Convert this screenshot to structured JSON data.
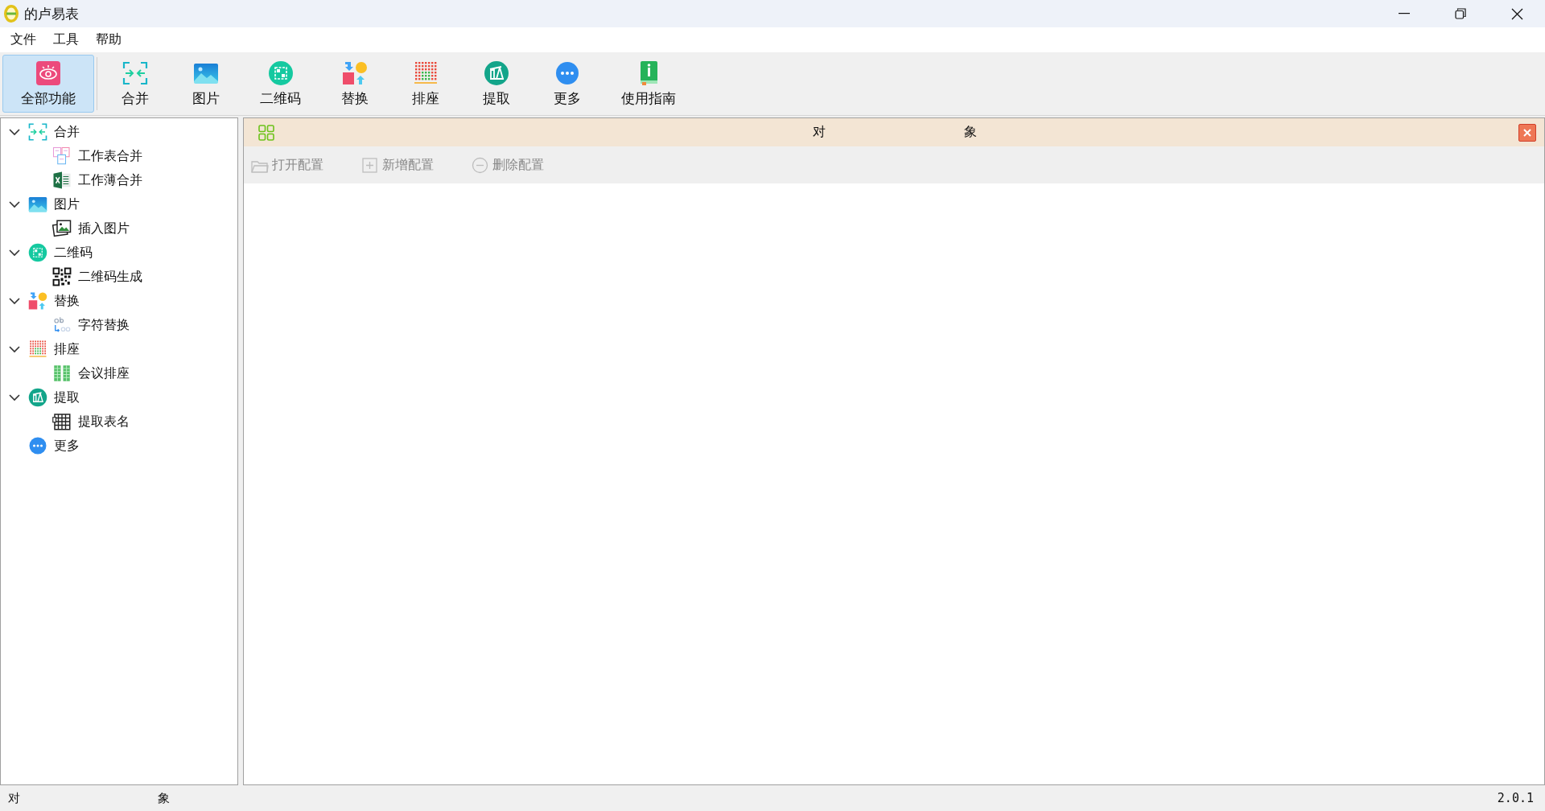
{
  "window": {
    "title": "的卢易表"
  },
  "menu": [
    "文件",
    "工具",
    "帮助"
  ],
  "toolbar": [
    {
      "label": "全部功能",
      "selected": true
    },
    {
      "label": "合并",
      "selected": false
    },
    {
      "label": "图片",
      "selected": false
    },
    {
      "label": "二维码",
      "selected": false
    },
    {
      "label": "替换",
      "selected": false
    },
    {
      "label": "排座",
      "selected": false
    },
    {
      "label": "提取",
      "selected": false
    },
    {
      "label": "更多",
      "selected": false
    },
    {
      "label": "使用指南",
      "selected": false
    }
  ],
  "tree": [
    {
      "label": "合并",
      "expanded": true,
      "children": [
        {
          "label": "工作表合并"
        },
        {
          "label": "工作薄合并"
        }
      ]
    },
    {
      "label": "图片",
      "expanded": true,
      "children": [
        {
          "label": "插入图片"
        }
      ]
    },
    {
      "label": "二维码",
      "expanded": true,
      "children": [
        {
          "label": "二维码生成"
        }
      ]
    },
    {
      "label": "替换",
      "expanded": true,
      "children": [
        {
          "label": "字符替换"
        }
      ]
    },
    {
      "label": "排座",
      "expanded": true,
      "children": [
        {
          "label": "会议排座"
        }
      ]
    },
    {
      "label": "提取",
      "expanded": true,
      "children": [
        {
          "label": "提取表名"
        }
      ]
    },
    {
      "label": "更多"
    }
  ],
  "panel": {
    "header": {
      "text_1": "对",
      "text_2": "象"
    },
    "actions": [
      {
        "label": "打开配置",
        "disabled": true
      },
      {
        "label": "新增配置",
        "disabled": true
      },
      {
        "label": "删除配置",
        "disabled": true
      }
    ]
  },
  "status_bar": {
    "text_1": "对",
    "text_2": "象",
    "version": "2.0.1"
  }
}
